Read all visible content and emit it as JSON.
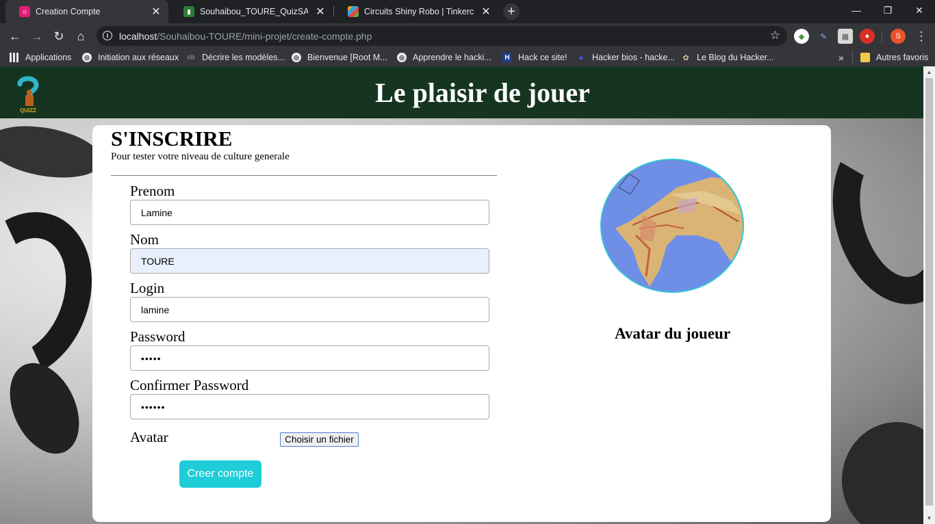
{
  "browser": {
    "tabs": [
      {
        "title": "Creation Compte",
        "favicon_color": "#e31c79",
        "active": true
      },
      {
        "title": "Souhaibou_TOURE_QuizSA | Trello",
        "favicon_color": "#2e7d32",
        "active": false
      },
      {
        "title": "Circuits Shiny Robo | Tinkercad",
        "favicon_color": "#e2a52b",
        "active": false
      }
    ],
    "url_host": "localhost",
    "url_path": "/Souhaibou-TOURE/mini-projet/create-compte.php",
    "bookmarks": [
      {
        "label": "Applications",
        "icon": "apps-grid-icon"
      },
      {
        "label": "Initiation aux réseaux",
        "icon": "globe-icon"
      },
      {
        "label": "Décrire les modèles...",
        "icon": "cisco-icon"
      },
      {
        "label": "Bienvenue [Root M...",
        "icon": "globe-icon"
      },
      {
        "label": "Apprendre le hacki...",
        "icon": "globe-icon"
      },
      {
        "label": "Hack ce site!",
        "icon": "hack-icon"
      },
      {
        "label": "Hacker bios - hacke...",
        "icon": "triangle-icon"
      },
      {
        "label": "Le Blog du Hacker...",
        "icon": "blog-icon"
      }
    ],
    "bookmarks_overflow": "»",
    "other_bookmarks": "Autres favoris",
    "profile_initial": "S"
  },
  "header": {
    "title": "Le plaisir de jouer",
    "logo_text": "QUIZZ"
  },
  "form": {
    "title": "S'INSCRIRE",
    "subtitle": "Pour tester votre niveau de culture generale",
    "fields": [
      {
        "label": "Prenom",
        "value": "Lamine"
      },
      {
        "label": "Nom",
        "value": "TOURE"
      },
      {
        "label": "Login",
        "value": "lamine"
      },
      {
        "label": "Password",
        "value": "•••••"
      },
      {
        "label": "Confirmer Password",
        "value": "••••••"
      }
    ],
    "avatar_label": "Avatar",
    "file_button": "Choisir un fichier",
    "submit": "Creer compte"
  },
  "avatar_panel": {
    "caption": "Avatar du joueur"
  },
  "colors": {
    "header_bg": "#153520",
    "accent": "#1ecdd8",
    "autofill_bg": "#e8f0fe"
  }
}
